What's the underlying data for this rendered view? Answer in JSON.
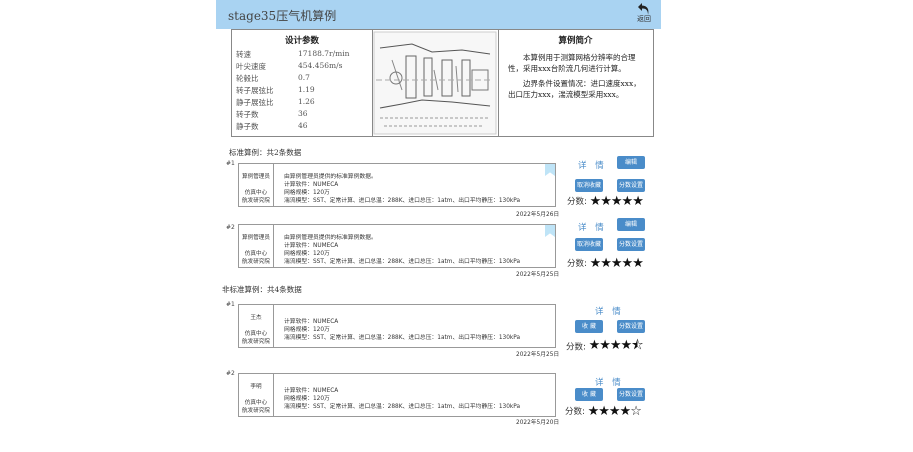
{
  "header": {
    "title": "stage35压气机算例",
    "back_label": "返回"
  },
  "params": {
    "title": "设计参数",
    "rows": [
      {
        "k": "转速",
        "v": "17188.7r/min"
      },
      {
        "k": "叶尖速度",
        "v": "454.456m/s"
      },
      {
        "k": "轮毂比",
        "v": "0.7"
      },
      {
        "k": "转子展弦比",
        "v": "1.19"
      },
      {
        "k": "静子展弦比",
        "v": "1.26"
      },
      {
        "k": "转子数",
        "v": "36"
      },
      {
        "k": "静子数",
        "v": "46"
      }
    ]
  },
  "intro": {
    "title": "算例简介",
    "p1": "本算例用于测算网格分辨率的合理性，采用xxx台阶流几何进行计算。",
    "p2": "边界条件设置情况：进口速度xxx，出口压力xxx，湍流模型采用xxx。"
  },
  "standard": {
    "heading": "标准算例：共2条数据",
    "items": [
      {
        "idx": "#1",
        "name": "算例管理员",
        "org": "仿真中心\n航发研究院",
        "l1": "由算例管理员提供的标准算例数据。",
        "l2": "计算软件：NUMECA",
        "l3": "网格规模：120万",
        "l4": "湍流模型：SST、定常计算、进口总温：288K、进口总压：1atm、出口平均静压：130kPa",
        "date": "2022年5月26日",
        "detail": "详 情",
        "edit": "编辑",
        "btn1": "取消收藏",
        "btn2": "分数设置",
        "score_label": "分数:",
        "stars": "★★★★★",
        "rating": 5
      },
      {
        "idx": "#2",
        "name": "算例管理员",
        "org": "仿真中心\n航发研究院",
        "l1": "由算例管理员提供的标准算例数据。",
        "l2": "计算软件：NUMECA",
        "l3": "网格规模：120万",
        "l4": "湍流模型：SST、定常计算、进口总温：288K、进口总压：1atm、出口平均静压：130kPa",
        "date": "2022年5月25日",
        "detail": "详 情",
        "edit": "编辑",
        "btn1": "取消收藏",
        "btn2": "分数设置",
        "score_label": "分数:",
        "stars": "★★★★★",
        "rating": 5
      }
    ]
  },
  "nonstandard": {
    "heading": "非标准算例：共4条数据",
    "items": [
      {
        "idx": "#1",
        "name": "王杰",
        "org": "仿真中心\n航发研究院",
        "l2": "计算软件：NUMECA",
        "l3": "网格规模：120万",
        "l4": "湍流模型：SST、定常计算、进口总温：288K、进口总压：1atm、出口平均静压：130kPa",
        "date": "2022年5月25日",
        "detail": "详 情",
        "btn1": "收 藏",
        "btn2": "分数设置",
        "score_label": "分数:",
        "stars": "★★★★⯪",
        "rating": 4.5
      },
      {
        "idx": "#2",
        "name": "李明",
        "org": "仿真中心\n航发研究院",
        "l2": "计算软件：NUMECA",
        "l3": "网格规模：120万",
        "l4": "湍流模型：SST、定常计算、进口总温：288K、进口总压：1atm、出口平均静压：130kPa",
        "date": "2022年5月20日",
        "detail": "详 情",
        "btn1": "收 藏",
        "btn2": "分数设置",
        "score_label": "分数:",
        "stars": "★★★★☆",
        "rating": 4
      }
    ]
  }
}
